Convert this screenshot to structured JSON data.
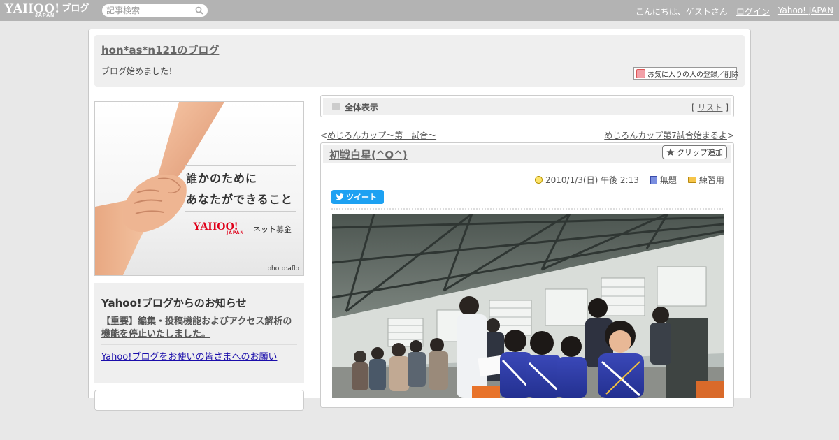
{
  "topbar": {
    "logo_main": "YAHOO!",
    "logo_sub": "JAPAN",
    "logo_blog": "ブログ",
    "search_placeholder": "記事検索",
    "greeting": "こんにちは、ゲストさん",
    "login": "ログイン",
    "yahoo_japan": "Yahoo! JAPAN"
  },
  "header": {
    "blog_title": "hon*as*n121のブログ",
    "description": "ブログ始めました！",
    "fav_button": "お気に入りの人の登録／削除"
  },
  "ad": {
    "line1": "誰かのために",
    "line2": "あなたができること",
    "logo": "YAHOO!",
    "logo_sub": "JAPAN",
    "product": "ネット募金",
    "credit": "photo:aflo"
  },
  "notice": {
    "title": "Yahoo!ブログからのお知らせ",
    "link1": "【重要】編集・投稿機能およびアクセス解析の機能を停止いたしました。",
    "link2": "Yahoo!ブログをお使いの皆さまへのお願い"
  },
  "view_bar": {
    "label": "全体表示",
    "list_open": "[ ",
    "list_link": "リスト",
    "list_close": " ]"
  },
  "nav": {
    "prev_mark": "<",
    "prev": "めじろんカップ～第一試合～",
    "next": "めじろんカップ第7試合始まるよ",
    "next_mark": ">"
  },
  "post": {
    "title": "初戦白星(^O^)",
    "clip_button": "クリップ追加",
    "date": "2010/1/3(日) 午後 2:13",
    "theme": "無題",
    "category": "練習用",
    "tweet": "ツイート"
  },
  "colors": {
    "topbar": "#b3b3b3",
    "tweet": "#1da1f2",
    "ad_logo": "#e0001a"
  }
}
